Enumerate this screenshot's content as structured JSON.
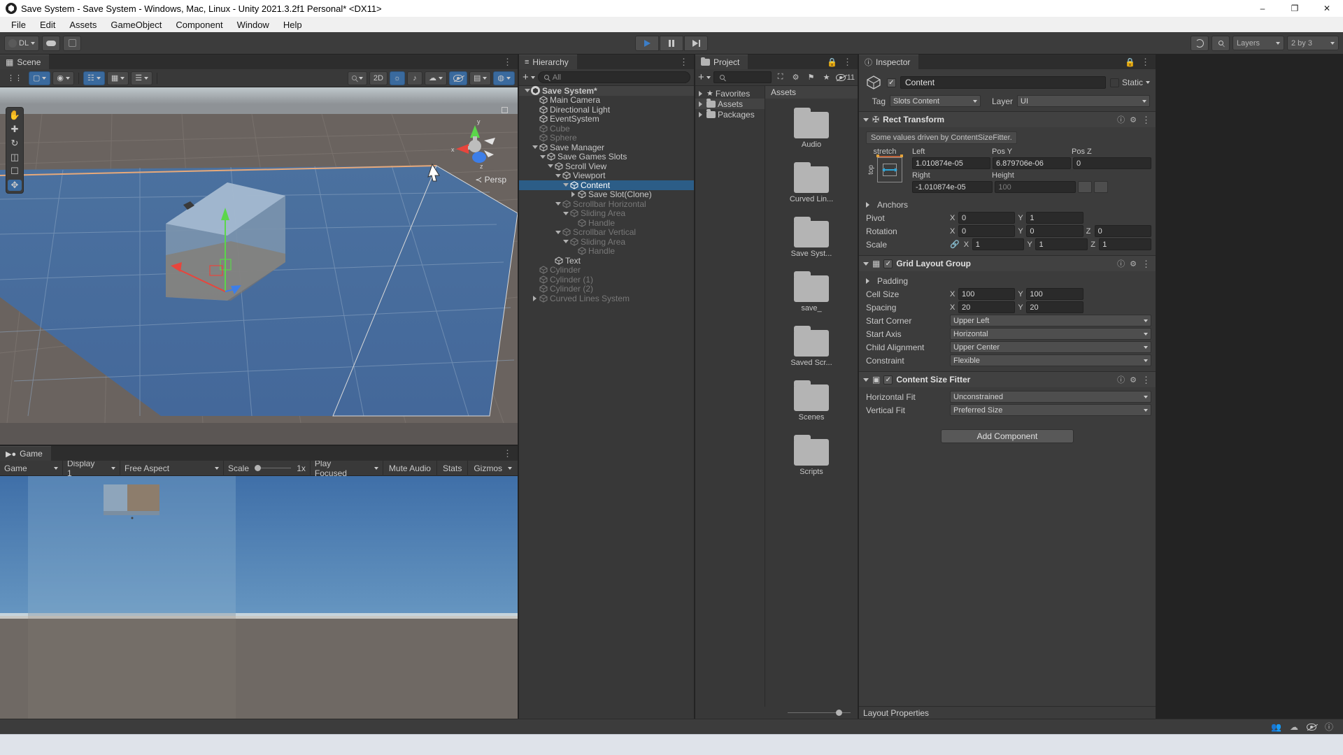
{
  "window": {
    "title": "Save System - Save System - Windows, Mac, Linux - Unity 2021.3.2f1 Personal* <DX11>",
    "minimize": "–",
    "maximize": "❐",
    "close": "✕"
  },
  "menu": {
    "items": [
      "File",
      "Edit",
      "Assets",
      "GameObject",
      "Component",
      "Window",
      "Help"
    ]
  },
  "toolbar": {
    "account_label": "DL",
    "cloud_icon": "cloud-icon",
    "collab_icon": "collab-icon",
    "play": "play-icon",
    "pause": "pause-icon",
    "step": "step-icon",
    "history_icon": "undo-history-icon",
    "search_icon": "search-icon",
    "layers_label": "Layers",
    "layout_label": "2 by 3"
  },
  "scene": {
    "tab": "Scene",
    "toolbar": {
      "hand": "hand-tool-icon",
      "move": "move-tool-icon",
      "rotate": "rotate-tool-icon",
      "scale": "scale-tool-icon",
      "rect": "rect-tool-icon",
      "transform": "transform-tool-icon",
      "pivot_mode": "Center",
      "pivot_rotation": "Global",
      "shading": "shaded-dropdown",
      "two_d": "2D",
      "lighting": "lighting-icon",
      "audio": "audio-icon",
      "fx": "effects-icon",
      "visibility": "scene-visibility-icon",
      "camera": "scene-camera-icon",
      "gizmos": "gizmos-icon"
    },
    "gizmo": {
      "persp_label": "Persp",
      "axis_x": "x",
      "axis_y": "y",
      "axis_z": "z"
    }
  },
  "game": {
    "tab": "Game",
    "display_target": "Game",
    "display": "Display 1",
    "aspect": "Free Aspect",
    "scale_label": "Scale",
    "scale_value": "1x",
    "play_focused": "Play Focused",
    "mute_audio": "Mute Audio",
    "stats": "Stats",
    "gizmos": "Gizmos"
  },
  "hierarchy": {
    "tab": "Hierarchy",
    "add_label": "+",
    "search_placeholder": "All",
    "items": [
      {
        "label": "Save System*",
        "depth": 0,
        "arrow": "open",
        "icon": "unity-scene-icon",
        "state": "root"
      },
      {
        "label": "Main Camera",
        "depth": 1,
        "arrow": "none",
        "icon": "gameobject-icon",
        "state": "normal"
      },
      {
        "label": "Directional Light",
        "depth": 1,
        "arrow": "none",
        "icon": "gameobject-icon",
        "state": "normal"
      },
      {
        "label": "EventSystem",
        "depth": 1,
        "arrow": "none",
        "icon": "gameobject-icon",
        "state": "normal"
      },
      {
        "label": "Cube",
        "depth": 1,
        "arrow": "none",
        "icon": "gameobject-icon",
        "state": "dim"
      },
      {
        "label": "Sphere",
        "depth": 1,
        "arrow": "none",
        "icon": "gameobject-icon",
        "state": "dim"
      },
      {
        "label": "Save Manager",
        "depth": 1,
        "arrow": "open",
        "icon": "gameobject-icon",
        "state": "normal"
      },
      {
        "label": "Save Games Slots",
        "depth": 2,
        "arrow": "open",
        "icon": "gameobject-icon",
        "state": "normal"
      },
      {
        "label": "Scroll View",
        "depth": 3,
        "arrow": "open",
        "icon": "gameobject-icon",
        "state": "normal"
      },
      {
        "label": "Viewport",
        "depth": 4,
        "arrow": "open",
        "icon": "gameobject-icon",
        "state": "normal"
      },
      {
        "label": "Content",
        "depth": 5,
        "arrow": "open",
        "icon": "gameobject-icon",
        "state": "selected"
      },
      {
        "label": "Save Slot(Clone)",
        "depth": 6,
        "arrow": "closed",
        "icon": "gameobject-icon",
        "state": "normal"
      },
      {
        "label": "Scrollbar Horizontal",
        "depth": 4,
        "arrow": "open",
        "icon": "gameobject-icon",
        "state": "dim"
      },
      {
        "label": "Sliding Area",
        "depth": 5,
        "arrow": "open",
        "icon": "gameobject-icon",
        "state": "dim"
      },
      {
        "label": "Handle",
        "depth": 6,
        "arrow": "none",
        "icon": "gameobject-icon",
        "state": "dim"
      },
      {
        "label": "Scrollbar Vertical",
        "depth": 4,
        "arrow": "open",
        "icon": "gameobject-icon",
        "state": "dim"
      },
      {
        "label": "Sliding Area",
        "depth": 5,
        "arrow": "open",
        "icon": "gameobject-icon",
        "state": "dim"
      },
      {
        "label": "Handle",
        "depth": 6,
        "arrow": "none",
        "icon": "gameobject-icon",
        "state": "dim"
      },
      {
        "label": "Text",
        "depth": 3,
        "arrow": "none",
        "icon": "gameobject-icon",
        "state": "normal"
      },
      {
        "label": "Cylinder",
        "depth": 1,
        "arrow": "none",
        "icon": "gameobject-icon",
        "state": "dim"
      },
      {
        "label": "Cylinder (1)",
        "depth": 1,
        "arrow": "none",
        "icon": "gameobject-icon",
        "state": "dim"
      },
      {
        "label": "Cylinder (2)",
        "depth": 1,
        "arrow": "none",
        "icon": "gameobject-icon",
        "state": "dim"
      },
      {
        "label": "Curved Lines System",
        "depth": 1,
        "arrow": "closed",
        "icon": "gameobject-icon",
        "state": "dim"
      }
    ]
  },
  "project": {
    "tab": "Project",
    "add_label": "+",
    "search_placeholder": "",
    "hidden_count": "11",
    "tree": [
      {
        "label": "Favorites",
        "icon": "star-icon",
        "selected": false
      },
      {
        "label": "Assets",
        "icon": "folder-icon",
        "selected": true
      },
      {
        "label": "Packages",
        "icon": "folder-icon",
        "selected": false
      }
    ],
    "breadcrumb": "Assets",
    "grid": [
      {
        "label": "Audio",
        "icon": "folder-icon"
      },
      {
        "label": "Curved Lin...",
        "icon": "folder-icon"
      },
      {
        "label": "Save Syst...",
        "icon": "folder-icon"
      },
      {
        "label": "save_",
        "icon": "folder-icon"
      },
      {
        "label": "Saved Scr...",
        "icon": "folder-icon"
      },
      {
        "label": "Scenes",
        "icon": "folder-icon"
      },
      {
        "label": "Scripts",
        "icon": "folder-icon"
      }
    ]
  },
  "inspector": {
    "tab": "Inspector",
    "object_enabled": true,
    "object_name": "Content",
    "static_label": "Static",
    "tag_label": "Tag",
    "tag_value": "Slots Content",
    "layer_label": "Layer",
    "layer_value": "UI",
    "rect_transform": {
      "title": "Rect Transform",
      "note": "Some values driven by ContentSizeFitter.",
      "anchor_preset": "stretch",
      "anchor_side": "top",
      "col_headers": [
        "Left",
        "Pos Y",
        "Pos Z"
      ],
      "row1": [
        "1.010874e-05",
        "6.879706e-06",
        "0"
      ],
      "col_headers2": [
        "Right",
        "Height",
        ""
      ],
      "row2": [
        "-1.010874e-05",
        "100",
        ""
      ],
      "anchors_label": "Anchors",
      "pivot_label": "Pivot",
      "pivot": {
        "x_label": "X",
        "x": "0",
        "y_label": "Y",
        "y": "1"
      },
      "rotation_label": "Rotation",
      "rotation": {
        "x_label": "X",
        "x": "0",
        "y_label": "Y",
        "y": "0",
        "z_label": "Z",
        "z": "0"
      },
      "scale_label": "Scale",
      "scale": {
        "x_label": "X",
        "x": "1",
        "y_label": "Y",
        "y": "1",
        "z_label": "Z",
        "z": "1"
      }
    },
    "grid_layout_group": {
      "title": "Grid Layout Group",
      "enabled": true,
      "padding_label": "Padding",
      "cell_size_label": "Cell Size",
      "cell_size": {
        "x_label": "X",
        "x": "100",
        "y_label": "Y",
        "y": "100"
      },
      "spacing_label": "Spacing",
      "spacing": {
        "x_label": "X",
        "x": "20",
        "y_label": "Y",
        "y": "20"
      },
      "start_corner_label": "Start Corner",
      "start_corner": "Upper Left",
      "start_axis_label": "Start Axis",
      "start_axis": "Horizontal",
      "child_alignment_label": "Child Alignment",
      "child_alignment": "Upper Center",
      "constraint_label": "Constraint",
      "constraint": "Flexible"
    },
    "content_size_fitter": {
      "title": "Content Size Fitter",
      "enabled": true,
      "horizontal_fit_label": "Horizontal Fit",
      "horizontal_fit": "Unconstrained",
      "vertical_fit_label": "Vertical Fit",
      "vertical_fit": "Preferred Size"
    },
    "add_component": "Add Component",
    "footer": "Layout Properties"
  },
  "colors": {
    "accent_selection": "#2c5d87",
    "panel_bg": "#383838",
    "header_bg": "#3c3c3c",
    "play_blue": "#3c7ec8",
    "toggle_blue": "#3a6a9e"
  }
}
